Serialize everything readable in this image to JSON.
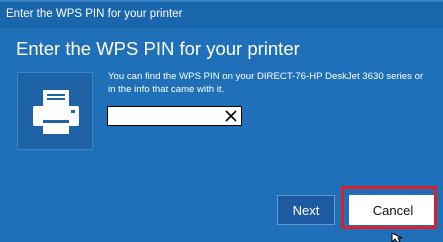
{
  "window": {
    "title": "Enter the WPS PIN for your printer"
  },
  "dialog": {
    "heading": "Enter the WPS PIN for your printer",
    "description_line1": "You can find the WPS PIN on your DIRECT-76-HP DeskJet 3630 series or",
    "description_line2": "in the info that came with it.",
    "pin_value": "",
    "pin_placeholder": ""
  },
  "buttons": {
    "next_label": "Next",
    "cancel_label": "Cancel"
  },
  "icons": {
    "printer": "printer-icon",
    "clear": "clear-icon",
    "cursor": "mouse-pointer-icon"
  },
  "colors": {
    "dialog_background": "#1f70b9",
    "highlight_border": "#d8202a"
  }
}
